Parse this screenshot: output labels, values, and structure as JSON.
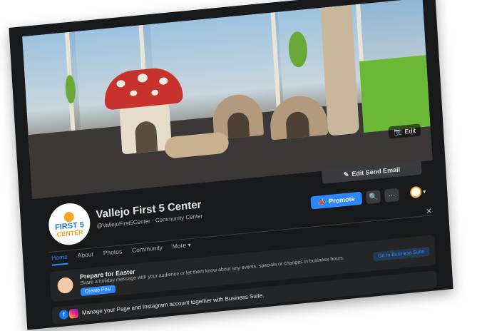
{
  "page": {
    "name": "Vallejo First 5 Center",
    "subtitle": "@VallejoFirst5Center · Community Center",
    "logo_line1": "FIRST 5",
    "logo_line2": "CENTER"
  },
  "cover": {
    "edit_label": "Edit"
  },
  "actions": {
    "edit_send_email": "Edit Send Email",
    "promote": "Promote",
    "search_glyph": "🔍",
    "more_glyph": "···",
    "profile_caret": "▾"
  },
  "tabs": [
    {
      "label": "Home"
    },
    {
      "label": "About"
    },
    {
      "label": "Photos"
    },
    {
      "label": "Community"
    },
    {
      "label": "More ▾"
    }
  ],
  "close_glyph": "✕",
  "easter": {
    "title": "Prepare for Easter",
    "description": "Share a holiday message with your audience or let them know about any events, specials or changes in business hours.",
    "create_post": "Create Post",
    "go_business": "Go to Business Suite"
  },
  "suite": {
    "text": "Manage your Page and Instagram account together with Business Suite.",
    "fb_glyph": "f"
  },
  "colors": {
    "accent": "#2d88ff",
    "background": "#18191a",
    "card": "#242526"
  },
  "icons": [
    "camera-icon",
    "pencil-icon",
    "megaphone-icon",
    "search-icon",
    "more-icon",
    "close-icon",
    "facebook-icon",
    "instagram-icon"
  ]
}
